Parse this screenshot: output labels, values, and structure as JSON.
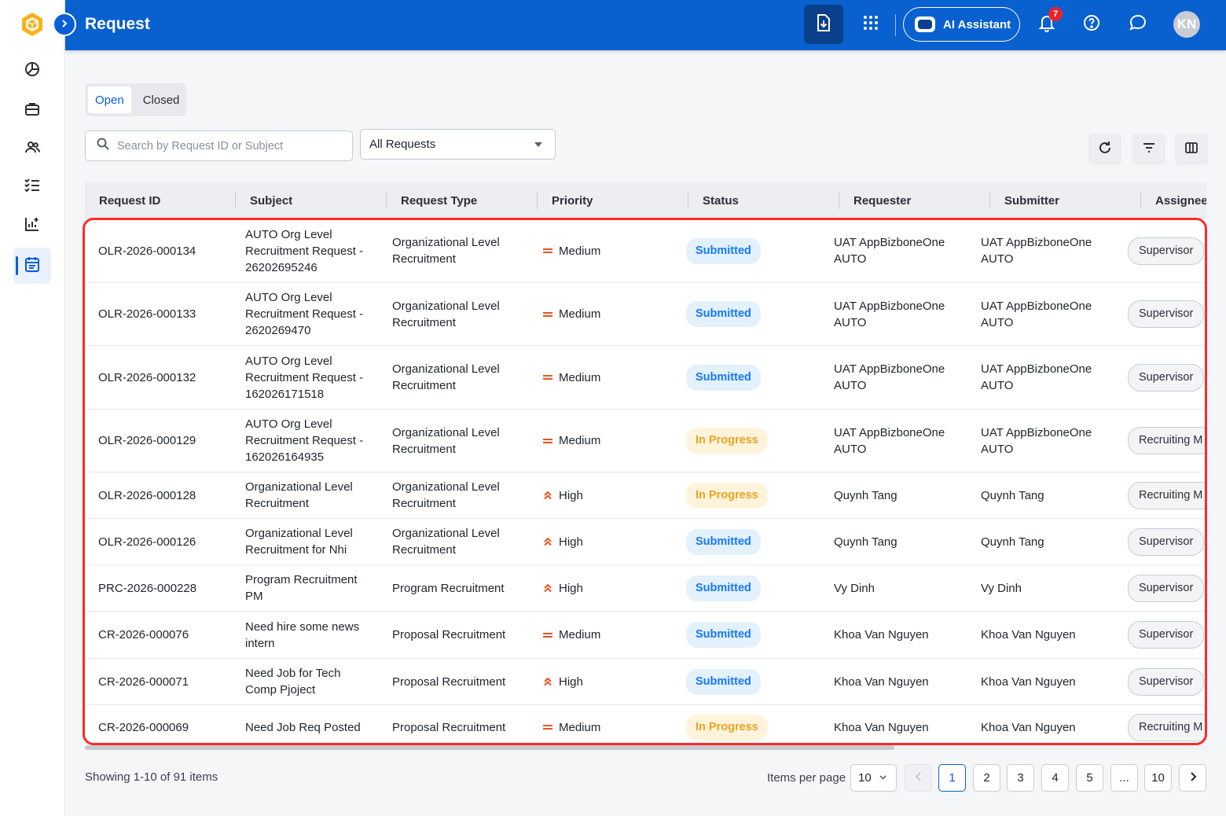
{
  "header": {
    "title": "Request",
    "ai_assistant_label": "AI Assistant",
    "notification_count": "7",
    "avatar_initials": "KN"
  },
  "tabs": [
    {
      "label": "Open",
      "active": true
    },
    {
      "label": "Closed",
      "active": false
    }
  ],
  "search": {
    "placeholder": "Search by Request ID or Subject"
  },
  "filter_select": {
    "value": "All Requests"
  },
  "table": {
    "columns": [
      "Request ID",
      "Subject",
      "Request Type",
      "Priority",
      "Status",
      "Requester",
      "Submitter",
      "Assignee"
    ],
    "rows": [
      {
        "id": "OLR-2026-000134",
        "subject": "AUTO Org Level Recruitment Request - 26202695246",
        "type": "Organizational Level Recruitment",
        "priority": "Medium",
        "status": "Submitted",
        "requester": "UAT AppBizboneOne AUTO",
        "submitter": "UAT AppBizboneOne AUTO",
        "assignee": "Supervisor"
      },
      {
        "id": "OLR-2026-000133",
        "subject": "AUTO Org Level Recruitment Request - 2620269470",
        "type": "Organizational Level Recruitment",
        "priority": "Medium",
        "status": "Submitted",
        "requester": "UAT AppBizboneOne AUTO",
        "submitter": "UAT AppBizboneOne AUTO",
        "assignee": "Supervisor"
      },
      {
        "id": "OLR-2026-000132",
        "subject": "AUTO Org Level Recruitment Request - 162026171518",
        "type": "Organizational Level Recruitment",
        "priority": "Medium",
        "status": "Submitted",
        "requester": "UAT AppBizboneOne AUTO",
        "submitter": "UAT AppBizboneOne AUTO",
        "assignee": "Supervisor"
      },
      {
        "id": "OLR-2026-000129",
        "subject": "AUTO Org Level Recruitment Request - 162026164935",
        "type": "Organizational Level Recruitment",
        "priority": "Medium",
        "status": "In Progress",
        "requester": "UAT AppBizboneOne AUTO",
        "submitter": "UAT AppBizboneOne AUTO",
        "assignee": "Recruiting M"
      },
      {
        "id": "OLR-2026-000128",
        "subject": "Organizational Level Recruitment",
        "type": "Organizational Level Recruitment",
        "priority": "High",
        "status": "In Progress",
        "requester": "Quynh Tang",
        "submitter": "Quynh Tang",
        "assignee": "Recruiting M"
      },
      {
        "id": "OLR-2026-000126",
        "subject": "Organizational Level Recruitment for Nhi",
        "type": "Organizational Level Recruitment",
        "priority": "High",
        "status": "Submitted",
        "requester": "Quynh Tang",
        "submitter": "Quynh Tang",
        "assignee": "Supervisor"
      },
      {
        "id": "PRC-2026-000228",
        "subject": "Program Recruitment PM",
        "type": "Program Recruitment",
        "priority": "High",
        "status": "Submitted",
        "requester": "Vy Dinh",
        "submitter": "Vy Dinh",
        "assignee": "Supervisor"
      },
      {
        "id": "CR-2026-000076",
        "subject": "Need hire some news intern",
        "type": "Proposal Recruitment",
        "priority": "Medium",
        "status": "Submitted",
        "requester": "Khoa Van Nguyen",
        "submitter": "Khoa Van Nguyen",
        "assignee": "Supervisor"
      },
      {
        "id": "CR-2026-000071",
        "subject": "Need Job for Tech Comp Pjoject",
        "type": "Proposal Recruitment",
        "priority": "High",
        "status": "Submitted",
        "requester": "Khoa Van Nguyen",
        "submitter": "Khoa Van Nguyen",
        "assignee": "Supervisor"
      },
      {
        "id": "CR-2026-000069",
        "subject": "Need Job Req Posted",
        "type": "Proposal Recruitment",
        "priority": "Medium",
        "status": "In Progress",
        "requester": "Khoa Van Nguyen",
        "submitter": "Khoa Van Nguyen",
        "assignee": "Recruiting M"
      }
    ]
  },
  "pagination": {
    "showing_text": "Showing 1-10 of 91 items",
    "items_per_page_label": "Items per page",
    "items_per_page_value": "10",
    "pages": [
      "1",
      "2",
      "3",
      "4",
      "5",
      "...",
      "10"
    ],
    "current_page": "1"
  },
  "colors": {
    "header_bg": "#0960cf",
    "accent": "#0b5ed7",
    "status_submitted": "#1677ff",
    "status_in_progress": "#f0a020",
    "priority_icon": "#e8541e",
    "highlight_border": "#ff2a2a"
  },
  "icons": {
    "sidebar": [
      "dashboard-icon",
      "briefcase-icon",
      "people-icon",
      "checklist-icon",
      "report-icon",
      "calendar-icon"
    ],
    "header": [
      "download-icon",
      "apps-grid-icon",
      "robot-icon",
      "bell-icon",
      "help-icon",
      "chat-icon"
    ],
    "toolbar": [
      "refresh-icon",
      "filter-icon",
      "columns-icon"
    ]
  }
}
